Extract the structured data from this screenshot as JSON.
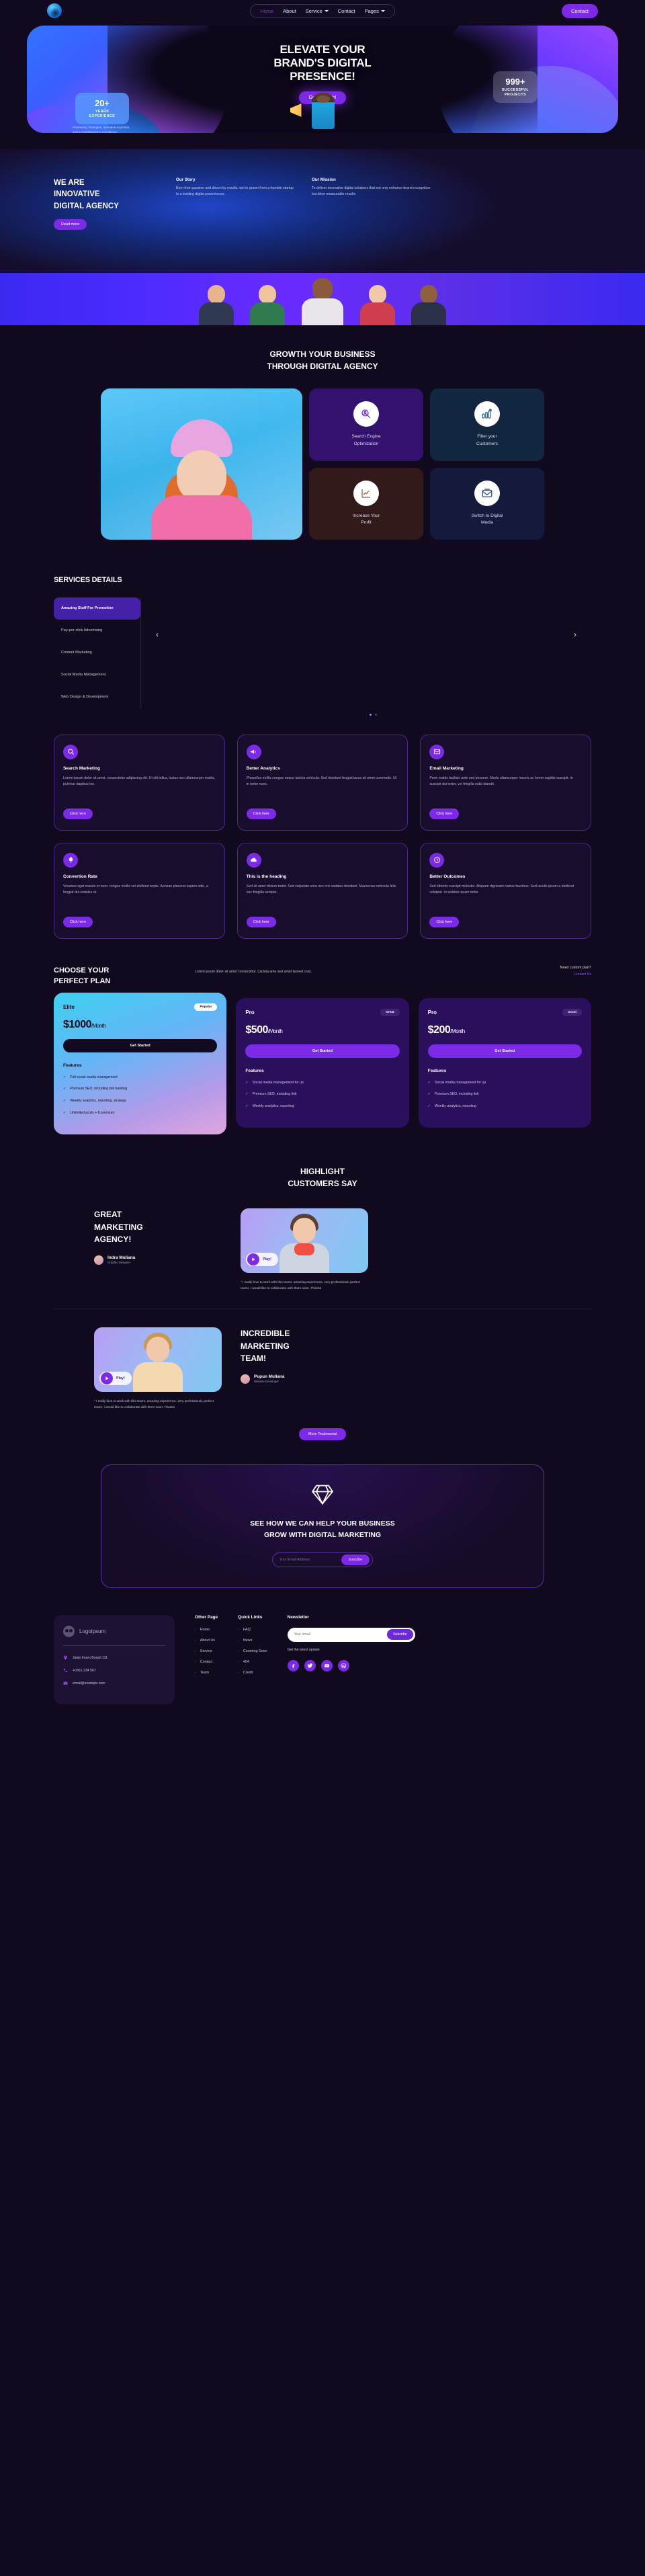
{
  "nav": {
    "logo_icon": "circle-swirl-logo",
    "items": [
      {
        "label": "Home",
        "active": true,
        "caret": false
      },
      {
        "label": "About",
        "active": false,
        "caret": false
      },
      {
        "label": "Service",
        "active": false,
        "caret": true
      },
      {
        "label": "Contact",
        "active": false,
        "caret": false
      },
      {
        "label": "Pages",
        "active": false,
        "caret": true
      }
    ],
    "cta_label": "Contact"
  },
  "hero": {
    "title_line1": "ELEVATE YOUR",
    "title_line2": "BRAND'S DIGITAL",
    "title_line3": "PRESENCE!",
    "cta_label": "Get in Touch!",
    "stat_left_number": "20+",
    "stat_left_label": "YEARS EXPERIENCE",
    "stat_left_note": "Pioneering strategies, unrivaled expertise, and a commitment to excellence.",
    "stat_right_number": "999+",
    "stat_right_label": "SUCCESSFUL PROJECTS"
  },
  "about": {
    "heading_l1": "WE ARE",
    "heading_l2": "INNOVATIVE",
    "heading_l3": "DIGITAL AGENCY",
    "read_more": "Read more",
    "story_title": "Our Story",
    "story_text": "Born from passion and driven by results, we've grown from a humble startup to a leading digital powerhouse.",
    "mission_title": "Our Mission",
    "mission_text": "To deliver innovative digital solutions that not only enhance brand recognition but drive measurable results"
  },
  "growth": {
    "title_l1": "GROWTH YOUR BUSINESS",
    "title_l2": "THROUGH DIGITAL AGENCY",
    "cards": [
      {
        "label_l1": "Search Engine",
        "label_l2": "Optimization",
        "icon": "magnifier-user-icon"
      },
      {
        "label_l1": "Filter your",
        "label_l2": "Customers",
        "icon": "bar-chart-arrow-icon"
      },
      {
        "label_l1": "Increase Your",
        "label_l2": "Profit",
        "icon": "line-chart-icon"
      },
      {
        "label_l1": "Switch to Digital",
        "label_l2": "Media",
        "icon": "envelope-open-icon"
      }
    ]
  },
  "services": {
    "title": "SERVICES DETAILS",
    "items": [
      {
        "label": "Amazing Stuff For Promotion",
        "active": true
      },
      {
        "label": "Pay-per-click Advertising",
        "active": false
      },
      {
        "label": "Content Marketing",
        "active": false
      },
      {
        "label": "Social Media Management",
        "active": false
      },
      {
        "label": "Web Design & Development",
        "active": false
      }
    ],
    "prev_icon": "chevron-left-icon",
    "next_icon": "chevron-right-icon"
  },
  "features": [
    {
      "icon": "search-icon",
      "title": "Search Marketing",
      "body": "Lorem ipsum dolor sit amet, consectetur adipiscing elit. Ut elit tellus, luctus nec ullamcorper mattis, pulvinar dapibus leo.",
      "btn": "Click here"
    },
    {
      "icon": "megaphone-icon",
      "title": "Better Analytics",
      "body": "Phasellus mollis congue neque lacinia vehicula. Sed tincidunt feugiat lacus sit amet commodo. Ut in tortor nunc.",
      "btn": "Click here"
    },
    {
      "icon": "envelope-icon",
      "title": "Email Marketing",
      "body": "Proin mattis facilisis ante sed posuere. Morbi ullamcorper mauris ac lorem sagittis suscipit. In suscipit dui tortor, vel fringilla nulla blandit.",
      "btn": "Click here"
    },
    {
      "icon": "rocket-icon",
      "title": "Convertion Rate",
      "body": "Vivamus eget mauris et nunc congue mollis vel eleifend turpis. Aenean placerat sapien odio, a feugiat dui sodales ut.",
      "btn": "Click here"
    },
    {
      "icon": "cloud-icon",
      "title": "This is the heading",
      "body": "Sed sit amet dictum tortor. Sed vulputate urna nec orci sodales tincidunt. Maecenas vehicula felis nec fringilla semper.",
      "btn": "Click here"
    },
    {
      "icon": "clock-icon",
      "title": "Better Outcomes",
      "body": "Sed lobortis suscipit molestie. Aliquam dignissim varius faucibus. Sed iaculis ipsum a eleifend volutpat. In sodales quam dolor.",
      "btn": "Click here"
    }
  ],
  "pricing": {
    "title_l1": "CHOOSE YOUR",
    "title_l2": "PERFECT PLAN",
    "subtitle": "Lorem ipsum dolor sit amet consectetur. Lacinia ante sed amet laoreet cras.",
    "need_label": "Need custom plan?",
    "contact_label": "Contact Us",
    "features_label": "Features",
    "plans": [
      {
        "name": "Elite",
        "badge": "Popular",
        "price": "$1000",
        "period": "/Month",
        "cta": "Get Started",
        "features": [
          "Full social media management",
          "Premium SEO, including link building",
          "Weekly analytics, reporting, strategy",
          "Unlimited posts + 8 premium"
        ]
      },
      {
        "name": "Pro",
        "badge": "Great",
        "price": "$500",
        "period": "/Month",
        "cta": "Get Started",
        "features": [
          "Social media management for up",
          "Premium SEO, including link",
          "Weekly analytics, reporting"
        ]
      },
      {
        "name": "Pro",
        "badge": "Good",
        "price": "$200",
        "period": "/Month",
        "cta": "Get Started",
        "features": [
          "Social media management for up",
          "Premium SEO, including link",
          "Weekly analytics, reporting"
        ]
      }
    ]
  },
  "testimonials": {
    "title_l1": "HIGHLIGHT",
    "title_l2": "CUSTOMERS SAY",
    "play_label": "Play!",
    "first": {
      "heading_l1": "GREAT",
      "heading_l2": "MARKETING",
      "heading_l3": "AGENCY!",
      "name": "Indra Muliana",
      "role": "Graphic Designer",
      "quote": "\" I really love to work with this team!, amazing experience, very professional, perfect team!, i would like to collaborate with them soon. Thanks"
    },
    "second": {
      "heading_l1": "INCREDIBLE",
      "heading_l2": "MARKETING",
      "heading_l3": "TEAM!",
      "name": "Pupun Muliana",
      "role": "Website Developer",
      "quote": "\" I really love to work with this team!, amazing experience, very professional, perfect team!, i would like to collaborate with them soon. Thanks"
    },
    "more_label": "More Testimonial"
  },
  "cta": {
    "icon": "diamond-icon",
    "heading_l1": "SEE HOW WE CAN HELP YOUR BUSINESS",
    "heading_l2": "GROW WITH DIGITAL MARKETING",
    "placeholder": "Your Email Address",
    "button": "Subcribe"
  },
  "footer": {
    "brand": "Logoipsum",
    "address": "Jalan Imam Bonjol 111",
    "phone": "+0361 234 567",
    "email": "email@example.com",
    "col1_title": "Other Page",
    "col1": [
      "Home",
      "About Us",
      "Service",
      "Contact",
      "Team"
    ],
    "col2_title": "Quick Links",
    "col2": [
      "FAQ",
      "News",
      "Cooming Soon",
      "404",
      "Credit"
    ],
    "news_title": "Newsletter",
    "news_placeholder": "Your email",
    "news_button": "Subcribe",
    "news_note": "Get the latest update",
    "socials": [
      "facebook-icon",
      "twitter-icon",
      "youtube-icon",
      "wordpress-icon"
    ]
  },
  "colors": {
    "accent": "#7c2ae8",
    "bg": "#110A1E",
    "blue": "#2f7bff"
  }
}
